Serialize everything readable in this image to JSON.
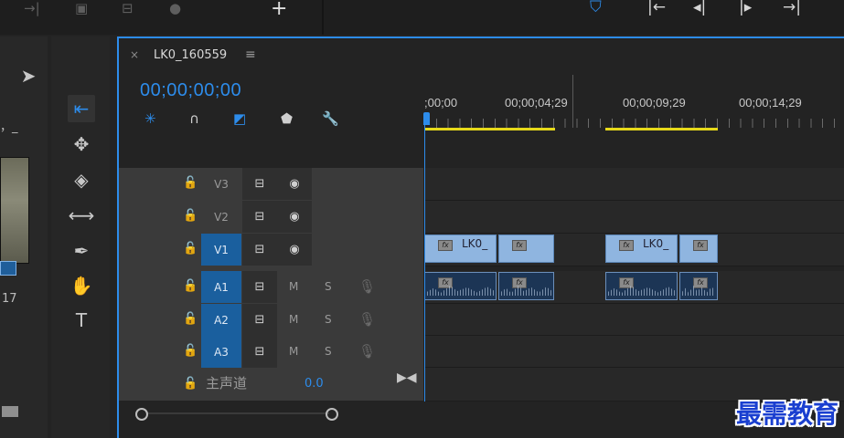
{
  "sequence": {
    "name": "LK0_160559",
    "timecode": "00;00;00;00",
    "close_glyph": "×",
    "menu_glyph": "≡"
  },
  "ruler": {
    "labels": [
      ";00;00",
      "00;00;04;29",
      "00;00;09;29",
      "00;00;14;29"
    ]
  },
  "tracks": {
    "video": [
      {
        "label": "V3",
        "targeted": false
      },
      {
        "label": "V2",
        "targeted": false
      },
      {
        "label": "V1",
        "targeted": true
      }
    ],
    "audio": [
      {
        "label": "A1",
        "m": "M",
        "s": "S"
      },
      {
        "label": "A2",
        "m": "M",
        "s": "S"
      },
      {
        "label": "A3",
        "m": "M",
        "s": "S"
      }
    ],
    "master": {
      "label": "主声道",
      "value": "0.0"
    }
  },
  "clips": {
    "v1": [
      {
        "label": "LK0_",
        "fx": "fx"
      },
      {
        "label": "",
        "fx": "fx"
      },
      {
        "label": "LK0_",
        "fx": "fx"
      },
      {
        "label": "",
        "fx": "fx"
      }
    ],
    "a1": [
      {
        "fx": "fx"
      },
      {
        "fx": "fx"
      },
      {
        "fx": "fx"
      },
      {
        "fx": "fx"
      }
    ]
  },
  "left_panel": {
    "number_text": "17",
    "comma_text": "，_"
  },
  "watermark": "最需教育",
  "colors": {
    "accent": "#2d8ceb",
    "target": "#1a5f9e",
    "video_clip": "#8fb5e0",
    "audio_clip": "#1c3555",
    "in_out_bar": "#e6d91a"
  }
}
